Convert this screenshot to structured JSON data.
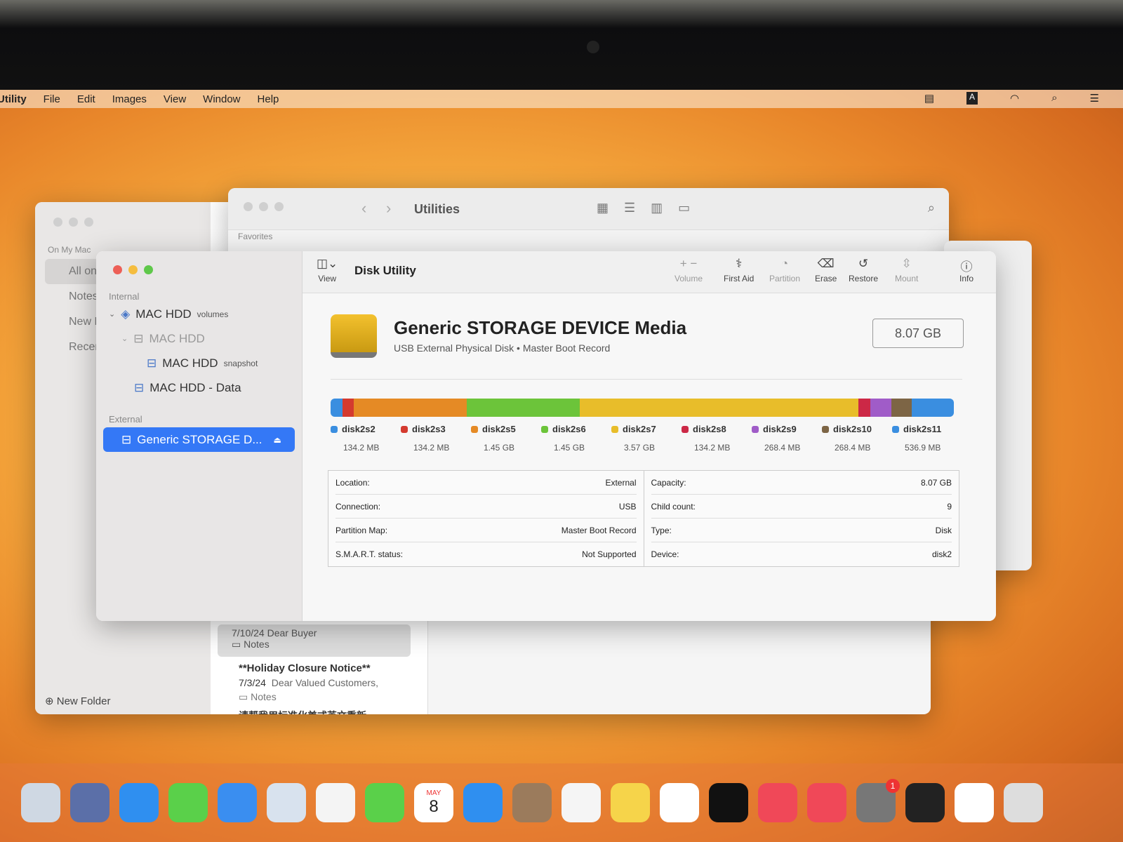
{
  "menubar": {
    "app": "Utility",
    "items": [
      "File",
      "Edit",
      "Images",
      "View",
      "Window",
      "Help"
    ],
    "input_badge": "A"
  },
  "finder_back": {
    "title": "Utilities",
    "favorites": "Favorites"
  },
  "notes_back": {
    "section": "On My Mac",
    "folders": [
      "All on My Mac",
      "Notes",
      "New Folder",
      "Recently Deleted"
    ],
    "new_folder": "New Folder",
    "notes": [
      {
        "title": "**Holiday Closure Notice**",
        "date": "7/3/24",
        "preview": "Dear Valued Customers,",
        "folder": "Notes"
      },
      {
        "title": "请帮我用标准化美式英文重新…"
      }
    ],
    "partial_note": {
      "date": "7/10/24",
      "preview": "Dear Buyer",
      "folder": "Notes"
    }
  },
  "disk_utility": {
    "title": "Disk Utility",
    "view_label": "View",
    "toolbar": [
      {
        "label": "Volume",
        "icon": "plus-minus-icon",
        "enabled": false
      },
      {
        "label": "First Aid",
        "icon": "stethoscope-icon",
        "enabled": true
      },
      {
        "label": "Partition",
        "icon": "pie-icon",
        "enabled": false
      },
      {
        "label": "Erase",
        "icon": "erase-icon",
        "enabled": true
      },
      {
        "label": "Restore",
        "icon": "restore-icon",
        "enabled": true
      },
      {
        "label": "Mount",
        "icon": "mount-icon",
        "enabled": false
      },
      {
        "label": "Info",
        "icon": "info-icon",
        "enabled": true
      }
    ],
    "sidebar": {
      "internal": "Internal",
      "external": "External",
      "items": [
        {
          "label": "MAC HDD",
          "tag": "volumes"
        },
        {
          "label": "MAC HDD",
          "tag": ""
        },
        {
          "label": "MAC HDD",
          "tag": "snapshot"
        },
        {
          "label": "MAC HDD - Data",
          "tag": ""
        }
      ],
      "selected": "Generic STORAGE D..."
    },
    "device": {
      "name": "Generic STORAGE DEVICE Media",
      "subtitle": "USB External Physical Disk • Master Boot Record",
      "size": "8.07 GB"
    },
    "partitions": [
      {
        "name": "disk2s2",
        "size": "134.2 MB",
        "color": "#3a8ee0"
      },
      {
        "name": "disk2s3",
        "size": "134.2 MB",
        "color": "#d43a2f"
      },
      {
        "name": "disk2s5",
        "size": "1.45 GB",
        "color": "#e58a25"
      },
      {
        "name": "disk2s6",
        "size": "1.45 GB",
        "color": "#6cc43a"
      },
      {
        "name": "disk2s7",
        "size": "3.57 GB",
        "color": "#e8bd2a"
      },
      {
        "name": "disk2s8",
        "size": "134.2 MB",
        "color": "#cc2846"
      },
      {
        "name": "disk2s9",
        "size": "268.4 MB",
        "color": "#a05cc8"
      },
      {
        "name": "disk2s10",
        "size": "268.4 MB",
        "color": "#7d6545"
      },
      {
        "name": "disk2s11",
        "size": "536.9 MB",
        "color": "#3a8ee0"
      }
    ],
    "info_left": [
      {
        "k": "Location:",
        "v": "External"
      },
      {
        "k": "Connection:",
        "v": "USB"
      },
      {
        "k": "Partition Map:",
        "v": "Master Boot Record"
      },
      {
        "k": "S.M.A.R.T. status:",
        "v": "Not Supported"
      }
    ],
    "info_right": [
      {
        "k": "Capacity:",
        "v": "8.07 GB"
      },
      {
        "k": "Child count:",
        "v": "9"
      },
      {
        "k": "Type:",
        "v": "Disk"
      },
      {
        "k": "Device:",
        "v": "disk2"
      }
    ]
  },
  "dock": {
    "calendar_month": "MAY",
    "calendar_day": "8",
    "settings_badge": "1",
    "items": [
      "Finder",
      "Launchpad",
      "Safari",
      "Messages",
      "Mail",
      "Maps",
      "Photos",
      "FaceTime",
      "Calendar",
      "App Store",
      "Contacts",
      "Reminders",
      "Notes",
      "Freeform",
      "TV",
      "Music",
      "News",
      "System Settings",
      "Terminal",
      "Chrome",
      "Disk Utility"
    ]
  }
}
